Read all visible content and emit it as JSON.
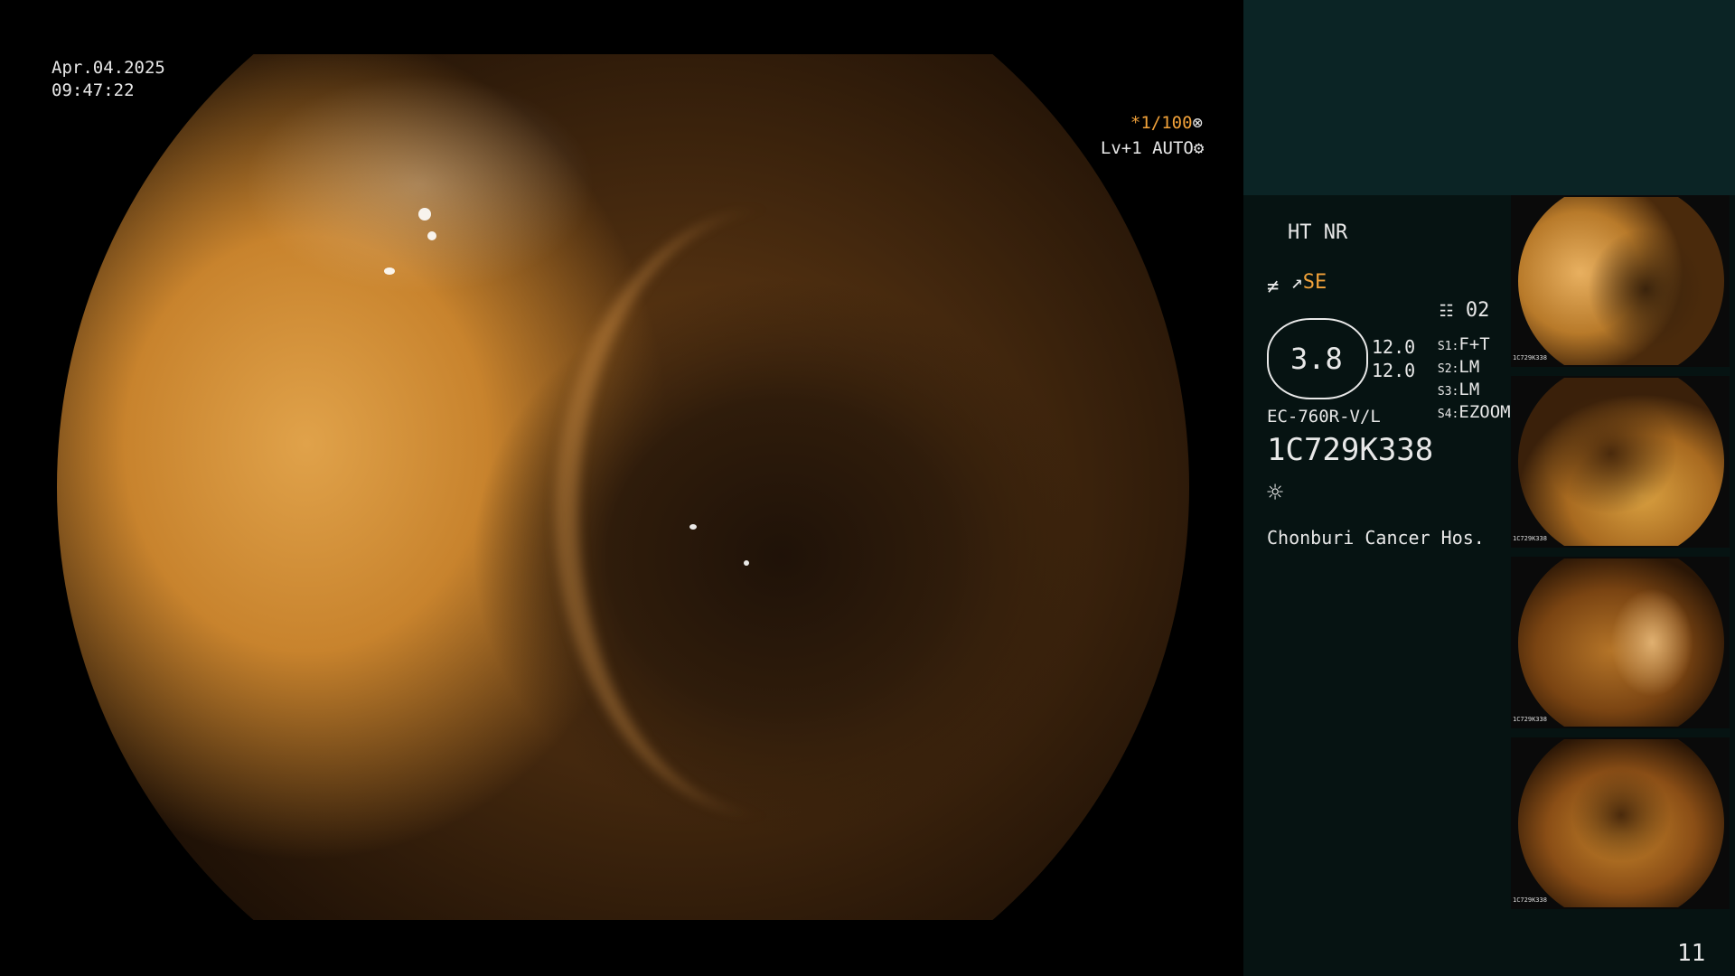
{
  "overlay": {
    "date": "Apr.04.2025",
    "time": "09:47:22",
    "shutter": "*1/100",
    "level": "Lv+1 AUTO"
  },
  "info": {
    "mode": "HT NR",
    "enhance": "SE",
    "channel": "02",
    "zoom_value": "3.8",
    "value_a": "12.0",
    "value_b": "12.0",
    "s1": "F+T",
    "s2": "LM",
    "s3": "LM",
    "s4": "EZOOM",
    "s1_label": "S1:",
    "s2_label": "S2:",
    "s3_label": "S3:",
    "s4_label": "S4:",
    "scope_model": "EC-760R-V/L",
    "serial": "1C729K338",
    "hospital": "Chonburi Cancer Hos."
  },
  "thumbnails": [
    {
      "label": "1C729K338"
    },
    {
      "label": "1C729K338"
    },
    {
      "label": "1C729K338"
    },
    {
      "label": "1C729K338"
    }
  ],
  "page_number": "11",
  "colors": {
    "accent": "#f2a23a",
    "panel": "#061312",
    "panel_top": "#0b2425"
  },
  "icons": {
    "aperture": "aperture-icon",
    "gear": "gear-icon",
    "light": "light-icon",
    "memo": "memo-icon"
  }
}
